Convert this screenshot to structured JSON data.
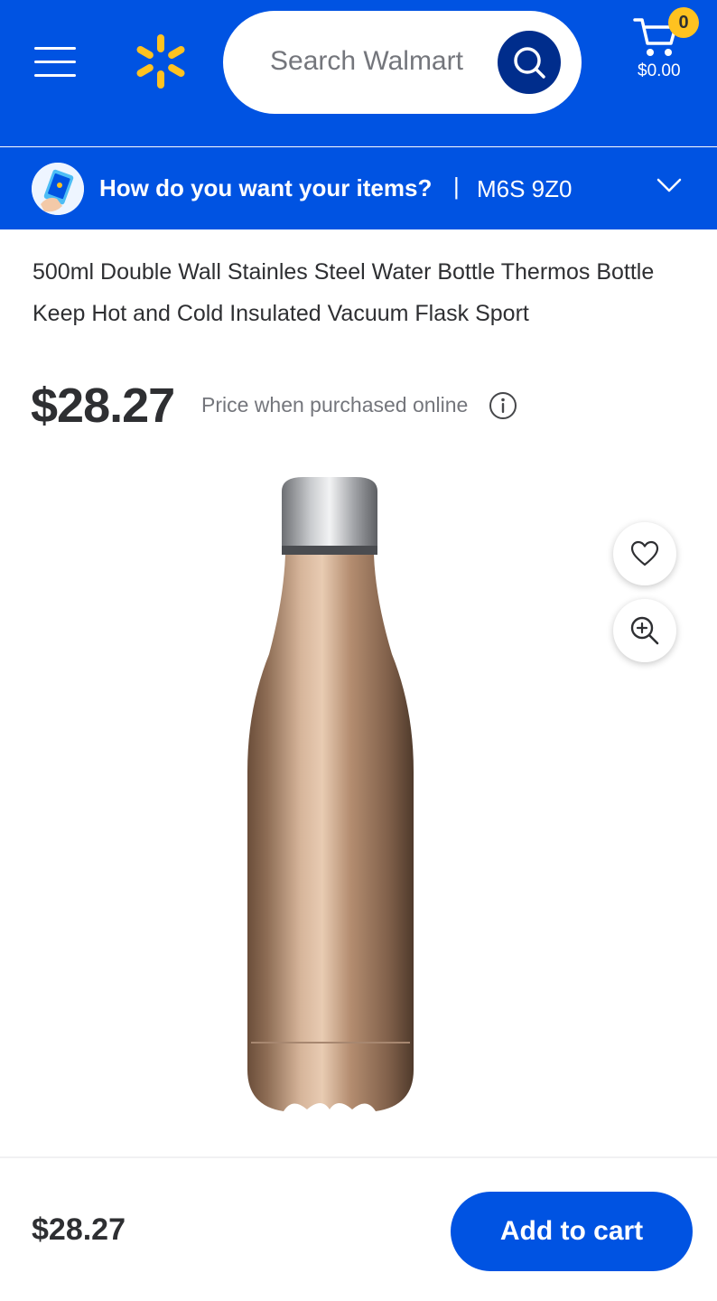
{
  "header": {
    "search_placeholder": "Search Walmart",
    "cart_count": "0",
    "cart_total": "$0.00",
    "brand_color": "#0053e2",
    "spark_color": "#ffc220"
  },
  "delivery": {
    "question": "How do you want your items?",
    "separator": "|",
    "postal_code": "M6S 9Z0"
  },
  "product": {
    "title": "500ml Double Wall Stainles Steel Water Bottle Thermos Bottle Keep Hot and Cold Insulated Vacuum Flask Sport",
    "price": "$28.27",
    "price_note": "Price when purchased online"
  },
  "bottom_bar": {
    "price": "$28.27",
    "add_to_cart_label": "Add to cart"
  }
}
